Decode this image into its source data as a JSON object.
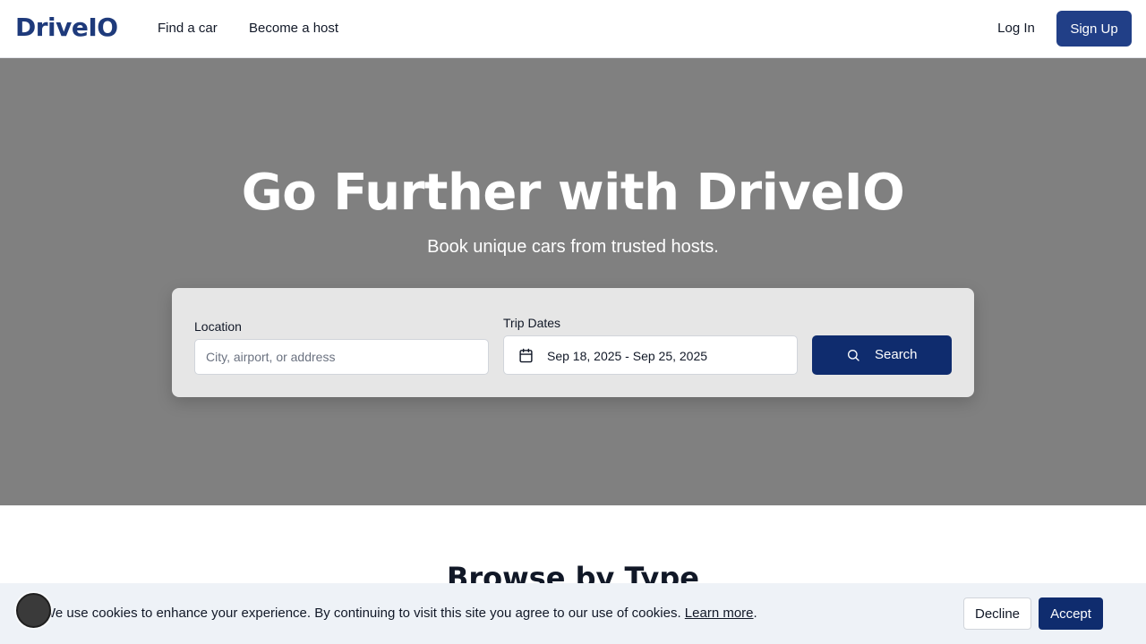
{
  "header": {
    "logo": "DriveIO",
    "nav": [
      "Find a car",
      "Become a host"
    ],
    "login_label": "Log In",
    "signup_label": "Sign Up"
  },
  "hero": {
    "title": "Go Further with DriveIO",
    "subtitle": "Book unique cars from trusted hosts.",
    "search": {
      "location_label": "Location",
      "location_placeholder": "City, airport, or address",
      "location_value": "",
      "dates_label": "Trip Dates",
      "dates_value": "Sep 18, 2025 - Sep 25, 2025",
      "button_label": "Search",
      "calendar_icon": "calendar-icon",
      "search_icon": "search-icon"
    }
  },
  "browse": {
    "title": "Browse by Type"
  },
  "cookie": {
    "text": "We use cookies to enhance your experience. By continuing to visit this site you agree to our use of cookies.",
    "link": "Learn more",
    "after_link": ".",
    "decline_label": "Decline",
    "accept_label": "Accept"
  },
  "colors": {
    "brand": "#1e3a7b",
    "primary_button": "#0f2c6e",
    "hero_bg": "#808080",
    "cookie_bg": "#eef2f7"
  }
}
